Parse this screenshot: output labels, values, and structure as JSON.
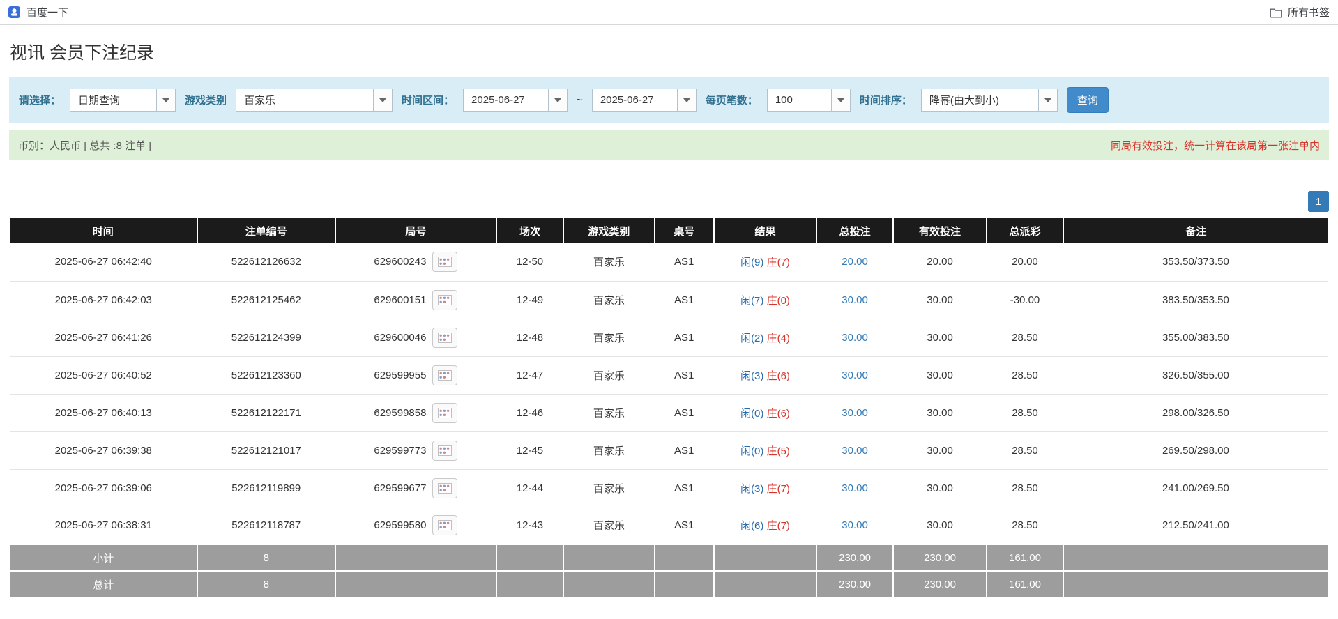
{
  "colors": {
    "accent": "#337ab7",
    "filter_bg": "#d9edf7",
    "summary_bg": "#dff0d8",
    "header_bg": "#1b1b1b",
    "footer_bg": "#9d9d9d",
    "label_blue": "#31708f",
    "player_blue": "#2b6dad",
    "banker_red": "#d9342b",
    "negative_red": "#d9342b",
    "notice_red": "#d9342b"
  },
  "browser_bar": {
    "bookmark_label": "百度一下",
    "all_bookmarks_label": "所有书签"
  },
  "page": {
    "title": "视讯 会员下注纪录"
  },
  "filters": {
    "select_label": "请选择：",
    "select_value": "日期查询",
    "game_type_label": "游戏类别",
    "game_type_value": "百家乐",
    "date_range_label": "时间区间：",
    "date_from": "2025-06-27",
    "date_separator": "~",
    "date_to": "2025-06-27",
    "page_size_label": "每页笔数：",
    "page_size_value": "100",
    "sort_label": "时间排序：",
    "sort_value": "降幂(由大到小)",
    "search_button": "查询"
  },
  "summary": {
    "info_text": "币别：人民币 | 总共 :8 注单 |",
    "notice_text": "同局有效投注，统一计算在该局第一张注单内"
  },
  "pagination": {
    "page": "1"
  },
  "table": {
    "headers": [
      "时间",
      "注单编号",
      "局号",
      "场次",
      "游戏类别",
      "桌号",
      "结果",
      "总投注",
      "有效投注",
      "总派彩",
      "备注"
    ],
    "rows": [
      {
        "time": "2025-06-27 06:42:40",
        "bet_id": "522612126632",
        "round_id": "629600243",
        "session": "12-50",
        "game": "百家乐",
        "table_no": "AS1",
        "result_player": "闲(9)",
        "result_banker": "庄(7)",
        "total_bet": "20.00",
        "valid_bet": "20.00",
        "payout": "20.00",
        "note": "353.50/373.50"
      },
      {
        "time": "2025-06-27 06:42:03",
        "bet_id": "522612125462",
        "round_id": "629600151",
        "session": "12-49",
        "game": "百家乐",
        "table_no": "AS1",
        "result_player": "闲(7)",
        "result_banker": "庄(0)",
        "total_bet": "30.00",
        "valid_bet": "30.00",
        "payout": "-30.00",
        "note": "383.50/353.50"
      },
      {
        "time": "2025-06-27 06:41:26",
        "bet_id": "522612124399",
        "round_id": "629600046",
        "session": "12-48",
        "game": "百家乐",
        "table_no": "AS1",
        "result_player": "闲(2)",
        "result_banker": "庄(4)",
        "total_bet": "30.00",
        "valid_bet": "30.00",
        "payout": "28.50",
        "note": "355.00/383.50"
      },
      {
        "time": "2025-06-27 06:40:52",
        "bet_id": "522612123360",
        "round_id": "629599955",
        "session": "12-47",
        "game": "百家乐",
        "table_no": "AS1",
        "result_player": "闲(3)",
        "result_banker": "庄(6)",
        "total_bet": "30.00",
        "valid_bet": "30.00",
        "payout": "28.50",
        "note": "326.50/355.00"
      },
      {
        "time": "2025-06-27 06:40:13",
        "bet_id": "522612122171",
        "round_id": "629599858",
        "session": "12-46",
        "game": "百家乐",
        "table_no": "AS1",
        "result_player": "闲(0)",
        "result_banker": "庄(6)",
        "total_bet": "30.00",
        "valid_bet": "30.00",
        "payout": "28.50",
        "note": "298.00/326.50"
      },
      {
        "time": "2025-06-27 06:39:38",
        "bet_id": "522612121017",
        "round_id": "629599773",
        "session": "12-45",
        "game": "百家乐",
        "table_no": "AS1",
        "result_player": "闲(0)",
        "result_banker": "庄(5)",
        "total_bet": "30.00",
        "valid_bet": "30.00",
        "payout": "28.50",
        "note": "269.50/298.00"
      },
      {
        "time": "2025-06-27 06:39:06",
        "bet_id": "522612119899",
        "round_id": "629599677",
        "session": "12-44",
        "game": "百家乐",
        "table_no": "AS1",
        "result_player": "闲(3)",
        "result_banker": "庄(7)",
        "total_bet": "30.00",
        "valid_bet": "30.00",
        "payout": "28.50",
        "note": "241.00/269.50"
      },
      {
        "time": "2025-06-27 06:38:31",
        "bet_id": "522612118787",
        "round_id": "629599580",
        "session": "12-43",
        "game": "百家乐",
        "table_no": "AS1",
        "result_player": "闲(6)",
        "result_banker": "庄(7)",
        "total_bet": "30.00",
        "valid_bet": "30.00",
        "payout": "28.50",
        "note": "212.50/241.00"
      }
    ],
    "subtotal": {
      "label": "小计",
      "count": "8",
      "total_bet": "230.00",
      "valid_bet": "230.00",
      "payout": "161.00"
    },
    "grand_total": {
      "label": "总计",
      "count": "8",
      "total_bet": "230.00",
      "valid_bet": "230.00",
      "payout": "161.00"
    }
  }
}
